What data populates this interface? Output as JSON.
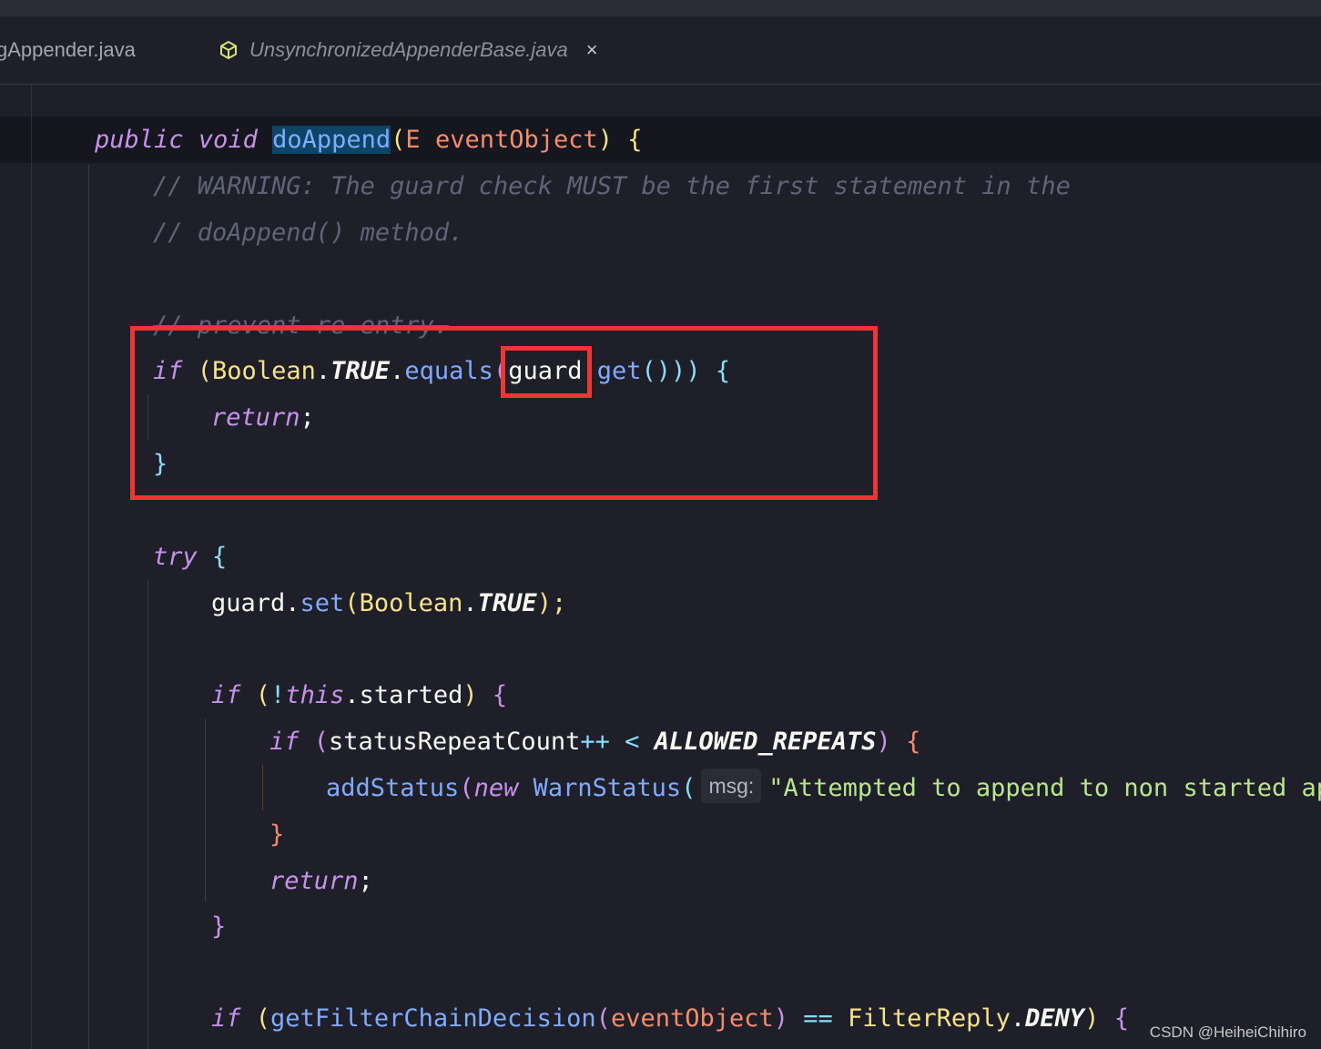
{
  "tabs": [
    {
      "label": "gAppender.java",
      "active": false
    },
    {
      "label": "UnsynchronizedAppenderBase.java",
      "active": true,
      "close": "×"
    }
  ],
  "code": {
    "l1": {
      "public": "public",
      "void": "void",
      "method": "doAppend",
      "open": "(",
      "type": "E",
      "param": "eventObject",
      "close": ")",
      "brace": "{"
    },
    "l2": {
      "comment": "// WARNING: The guard check MUST be the first statement in the"
    },
    "l3": {
      "comment": "// doAppend() method."
    },
    "l5": {
      "comment": "// prevent re-entry."
    },
    "l6": {
      "if": "if",
      "a": "(",
      "cls": "Boolean",
      "dot1": ".",
      "const": "TRUE",
      "dot2": ".",
      "fn": "equals",
      "b": "(",
      "var": "guard",
      "dot3": ".",
      "get": "get",
      "c": "()))",
      "brace": "{"
    },
    "l7": {
      "kw": "return",
      "semi": ";"
    },
    "l8": {
      "brace": "}"
    },
    "l10": {
      "kw": "try",
      "brace": "{"
    },
    "l11": {
      "var": "guard",
      "dot": ".",
      "fn": "set",
      "a": "(",
      "cls": "Boolean",
      "dot2": ".",
      "const": "TRUE",
      "b": ");"
    },
    "l13": {
      "if": "if",
      "a": "(",
      "not": "!",
      "this": "this",
      "rest": ".started",
      "b": ")",
      "brace": "{"
    },
    "l14": {
      "if": "if",
      "a": "(",
      "var": "statusRepeatCount",
      "op": "++ <",
      "const": "ALLOWED_REPEATS",
      "b": ")",
      "brace": "{"
    },
    "l15": {
      "fn": "addStatus",
      "a": "(",
      "new": "new",
      "cls": "WarnStatus",
      "b": "(",
      "hint": "msg:",
      "str": "\"Attempted to append to non started app"
    },
    "l16": {
      "brace": "}"
    },
    "l17": {
      "kw": "return",
      "semi": ";"
    },
    "l18": {
      "brace": "}"
    },
    "l20": {
      "if": "if",
      "a": "(",
      "fn": "getFilterChainDecision",
      "b": "(",
      "var": "eventObject",
      "c": ")",
      "op": "==",
      "cls": "FilterReply",
      "dot": ".",
      "const": "DENY",
      "d": ")",
      "brace": "{"
    }
  },
  "watermark": "CSDN @HeiheiChihiro",
  "colors": {
    "accent_tab": "#f0a020",
    "highlight_box": "#f03535",
    "selection": "#0c4566"
  }
}
